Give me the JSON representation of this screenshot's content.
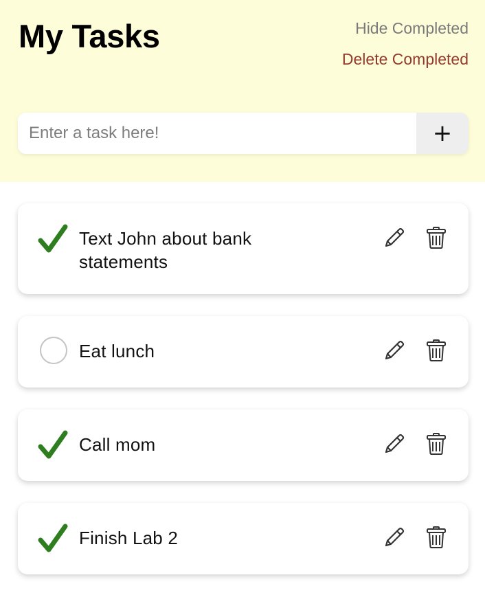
{
  "header": {
    "title": "My Tasks",
    "hide_completed_label": "Hide Completed",
    "delete_completed_label": "Delete Completed",
    "background_color": "#fdfdd9"
  },
  "add_task": {
    "placeholder": "Enter a task here!",
    "value": "",
    "add_button_label": "+"
  },
  "tasks": [
    {
      "text": "Text John about bank statements",
      "completed": true
    },
    {
      "text": "Eat lunch",
      "completed": false
    },
    {
      "text": "Call mom",
      "completed": true
    },
    {
      "text": "Finish Lab 2",
      "completed": true
    }
  ],
  "icons": {
    "complete": "checkmark-icon",
    "incomplete": "empty-circle-icon",
    "edit": "pencil-icon",
    "delete": "trash-icon"
  },
  "colors": {
    "check_green": "#2e7d1f",
    "delete_link": "#923a2e",
    "hide_link": "#7a7a7a"
  }
}
